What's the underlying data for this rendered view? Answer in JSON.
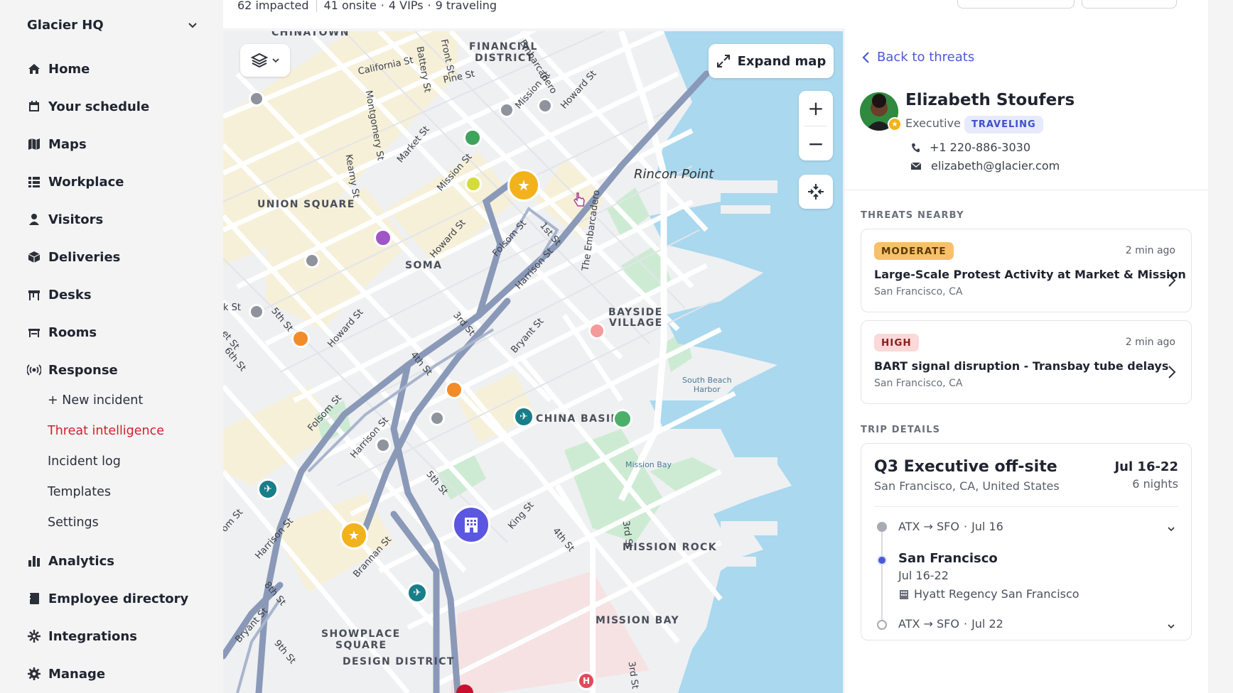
{
  "sidebar": {
    "org_name": "Glacier HQ",
    "items": [
      {
        "label": "Home",
        "icon": "home-icon"
      },
      {
        "label": "Your schedule",
        "icon": "calendar-icon"
      },
      {
        "label": "Maps",
        "icon": "map-icon"
      },
      {
        "label": "Workplace",
        "icon": "grid-icon"
      },
      {
        "label": "Visitors",
        "icon": "visitor-icon"
      },
      {
        "label": "Deliveries",
        "icon": "package-icon"
      },
      {
        "label": "Desks",
        "icon": "desk-icon"
      },
      {
        "label": "Rooms",
        "icon": "room-icon"
      },
      {
        "label": "Response",
        "icon": "broadcast-icon"
      }
    ],
    "response_sub": [
      {
        "label": "+ New incident"
      },
      {
        "label": "Threat intelligence"
      },
      {
        "label": "Incident log"
      },
      {
        "label": "Templates"
      },
      {
        "label": "Settings"
      }
    ],
    "bottom_items": [
      {
        "label": "Analytics",
        "icon": "chart-icon"
      },
      {
        "label": "Employee directory",
        "icon": "directory-icon"
      },
      {
        "label": "Integrations",
        "icon": "integrations-icon"
      },
      {
        "label": "Manage",
        "icon": "gear-icon"
      }
    ]
  },
  "stats": {
    "impacted": "62 impacted",
    "onsite": "41 onsite",
    "vips": "4 VIPs",
    "traveling": "9 traveling",
    "dot": "·"
  },
  "map": {
    "expand_label": "Expand map",
    "zoom_in": "+",
    "zoom_out": "−",
    "neighborhoods": {
      "chinatown": "CHINATOWN",
      "financial": "FINANCIAL",
      "district": "DISTRICT",
      "union_square": "UNION SQUARE",
      "soma": "SOMA",
      "bayside1": "BAYSIDE",
      "bayside2": "VILLAGE",
      "china_basin": "CHINA BASIN",
      "mission_rock": "MISSION ROCK",
      "mission_bay": "MISSION BAY",
      "showplace1": "SHOWPLACE",
      "showplace2": "SQUARE",
      "design": "DESIGN DISTRICT"
    },
    "rincon": "Rincon Point",
    "water": {
      "south_beach1": "South Beach",
      "south_beach2": "Harbor",
      "mission_bay": "Mission Bay"
    },
    "streets": {
      "california": "California St",
      "pine": "Pine St",
      "battery": "Battery St",
      "front": "Front St",
      "embarcadero_top": "Embarcadero",
      "mission1": "Mission St",
      "howard1": "Howard St",
      "montgomery": "Montgomery St",
      "market": "Market St",
      "kearny": "Kearny St",
      "mission2": "Mission St",
      "howard2": "Howard St",
      "folsom1": "Folsom St",
      "first": "1st St",
      "harrison1": "Harrison St",
      "the_embarcadero": "The Embarcadero",
      "fifth1": "5th St",
      "sixth": "6th St",
      "howard3": "Howard St",
      "third": "3rd St",
      "bryant1": "Bryant St",
      "fourth1": "4th St",
      "folsom2": "Folsom St",
      "harrison2": "Harrison St",
      "fifth2": "5th St",
      "king": "King St",
      "fourth2": "4th St",
      "third2": "3rd St",
      "harrison3": "Harrison St",
      "brannan": "Brannan St",
      "eighth": "8th St",
      "bryant2": "Bryant St",
      "ninth": "9th St",
      "third3": "3rd St",
      "k_st": "k St",
      "et_st": "et St",
      "om_st": "om St"
    }
  },
  "panel": {
    "back_label": "Back to threats",
    "person": {
      "name": "Elizabeth Stoufers",
      "role": "Executive",
      "status": "TRAVELING",
      "phone": "+1 220-886-3030",
      "email": "elizabeth@glacier.com"
    },
    "threats_title": "THREATS NEARBY",
    "threats": [
      {
        "severity": "MODERATE",
        "time": "2 min ago",
        "title": "Large-Scale Protest Activity at Market & Mission",
        "location": "San Francisco, CA"
      },
      {
        "severity": "HIGH",
        "time": "2 min ago",
        "title": "BART signal disruption - Transbay tube delays",
        "location": "San Francisco, CA"
      }
    ],
    "trip_title": "TRIP DETAILS",
    "trip": {
      "name": "Q3 Executive off-site",
      "location": "San Francisco, CA, United States",
      "dates": "Jul 16-22",
      "nights": "6 nights",
      "legs": [
        {
          "route": "ATX → SFO",
          "date": "Jul 16"
        },
        {
          "city": "San Francisco",
          "dates": "Jul 16-22",
          "hotel": "Hyatt Regency San Francisco"
        },
        {
          "route": "ATX → SFO",
          "date": "Jul 22"
        }
      ]
    }
  },
  "colors": {
    "accent": "#4b59d6",
    "active_nav": "#d11f2e",
    "water": "#a9d8ef",
    "park": "#c9ecd0",
    "road": "#ffffff",
    "highway": "#8a99b8"
  }
}
